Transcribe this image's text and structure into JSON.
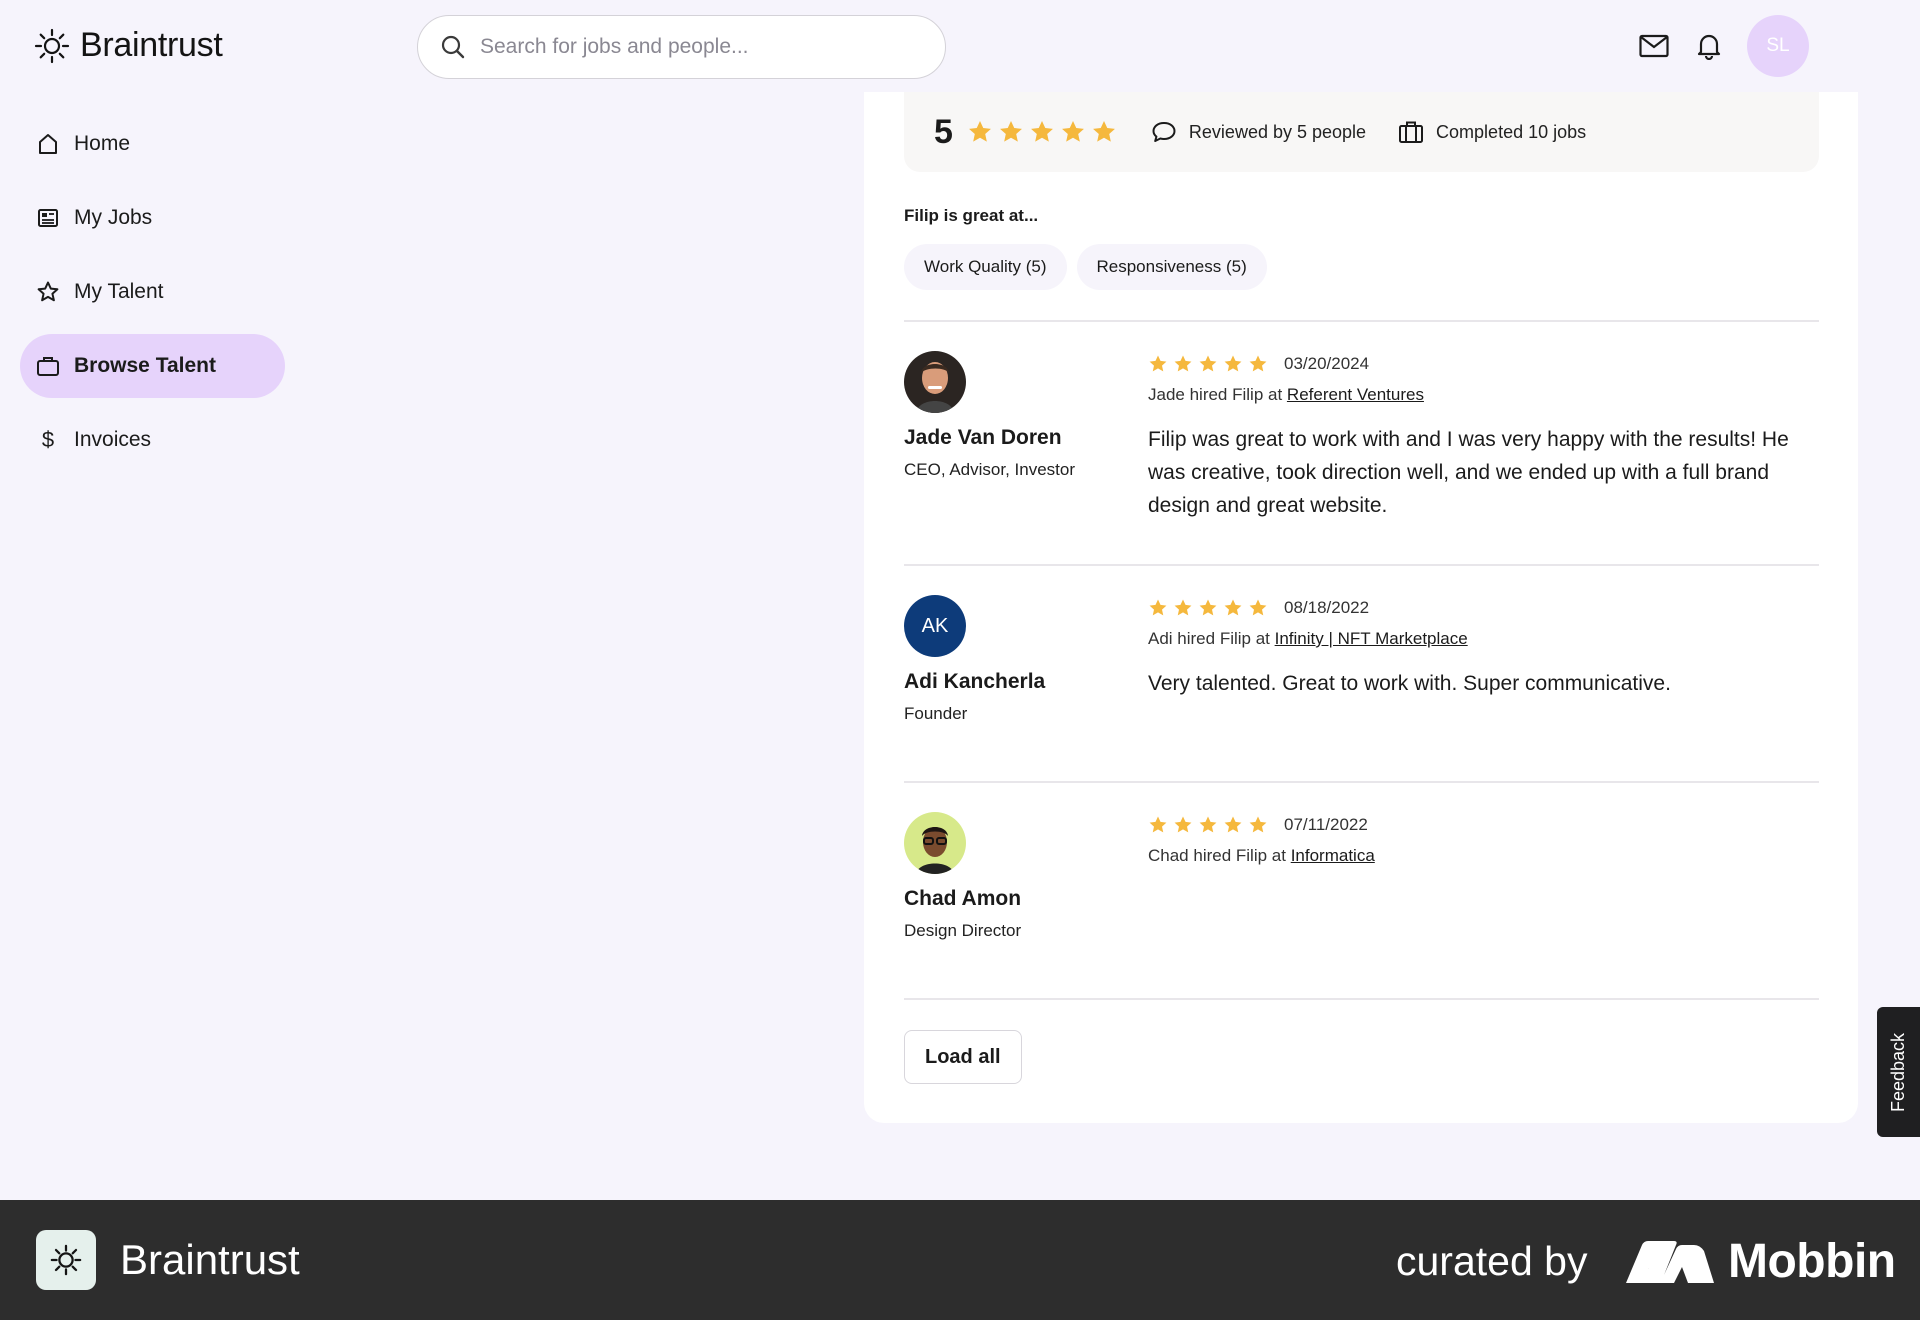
{
  "header": {
    "brand": "Braintrust",
    "search_placeholder": "Search for jobs and people...",
    "avatar_initials": "SL"
  },
  "sidebar": {
    "items": [
      {
        "label": "Home",
        "icon": "home-icon"
      },
      {
        "label": "My Jobs",
        "icon": "jobs-icon"
      },
      {
        "label": "My Talent",
        "icon": "star-icon"
      },
      {
        "label": "Browse Talent",
        "icon": "briefcase-icon",
        "active": true
      },
      {
        "label": "Invoices",
        "icon": "dollar-icon"
      }
    ]
  },
  "summary": {
    "rating": "5",
    "stars": 5,
    "reviewed_by": "Reviewed by 5 people",
    "completed": "Completed 10 jobs"
  },
  "strengths": {
    "label": "Filip is great at...",
    "tags": [
      "Work Quality (5)",
      "Responsiveness (5)"
    ]
  },
  "reviews": [
    {
      "name": "Jade Van Doren",
      "title": "CEO, Advisor, Investor",
      "stars": 5,
      "date": "03/20/2024",
      "hired_prefix": "Jade hired Filip at",
      "company": "Referent Ventures",
      "text": "Filip was great to work with and I was very happy with the results!  He was creative, took direction well, and we ended up with a full brand design and great website."
    },
    {
      "name": "Adi Kancherla",
      "title": "Founder",
      "initials": "AK",
      "stars": 5,
      "date": "08/18/2022",
      "hired_prefix": "Adi hired Filip at",
      "company": "Infinity | NFT Marketplace",
      "text": "Very talented. Great to work with. Super communicative."
    },
    {
      "name": "Chad Amon",
      "title": "Design Director",
      "stars": 5,
      "date": "07/11/2022",
      "hired_prefix": "Chad hired Filip at",
      "company": "Informatica",
      "text": ""
    }
  ],
  "load_all": "Load all",
  "feedback": "Feedback",
  "footer": {
    "brand": "Braintrust",
    "curated_by": "curated by",
    "mobbin": "Mobbin"
  },
  "colors": {
    "accent": "#e6d3fb",
    "star": "#f5b83d",
    "page_bg": "#f6f4fc",
    "footer_bg": "#2d2d2d",
    "ak_avatar": "#0d3b7a"
  }
}
